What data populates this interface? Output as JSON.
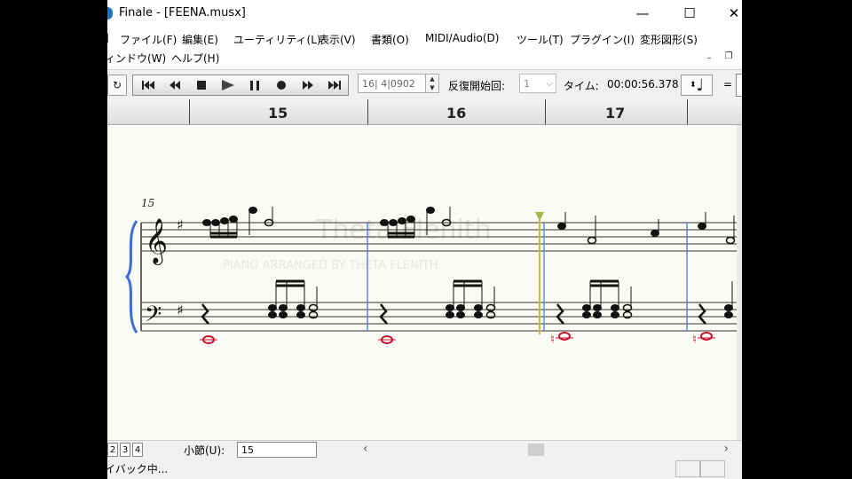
{
  "window": {
    "title": "Finale - [FEENA.musx]",
    "minimize": "—",
    "maximize": "☐",
    "close": "✕"
  },
  "menu": {
    "items_row1": [
      "ファイル(F)",
      "編集(E)",
      "ユーティリティ(L)",
      "表示(V)",
      "書類(O)",
      "MIDI/Audio(D)",
      "ツール(T)",
      "プラグイン(I)",
      "変形図形(S)"
    ],
    "items_row2": [
      "ィンドウ(W)",
      "ヘルプ(H)"
    ],
    "mdi_min": "–",
    "mdi_restore": "❐"
  },
  "toolbar": {
    "loop_icon": "↻",
    "counter_value": "16| 4|0902",
    "repeat_label": "反復開始回:",
    "repeat_value": "1",
    "time_label": "タイム:",
    "time_value": "00:00:56.378",
    "tempo_note": "♩",
    "tempo_equals": "="
  },
  "ruler": {
    "measures": [
      "15",
      "16",
      "17"
    ]
  },
  "score": {
    "measure_number": "15",
    "watermark_main": "Theta Flenith",
    "watermark_sub": "PIANO ARRANGED BY THETA FLENITH"
  },
  "statusbar": {
    "pages": [
      "2",
      "3",
      "4"
    ],
    "measure_label": "小節(U):",
    "measure_value": "15",
    "scroll_left": "‹",
    "scroll_right": "›",
    "playback_status": "イバック中..."
  },
  "colors": {
    "score_bg": "#fbfaf5",
    "barline_blue": "#4a6fd6",
    "playback_cursor": "#b8c44a",
    "bass_note_red": "#c8102e",
    "brace_blue": "#3b6fd6"
  }
}
